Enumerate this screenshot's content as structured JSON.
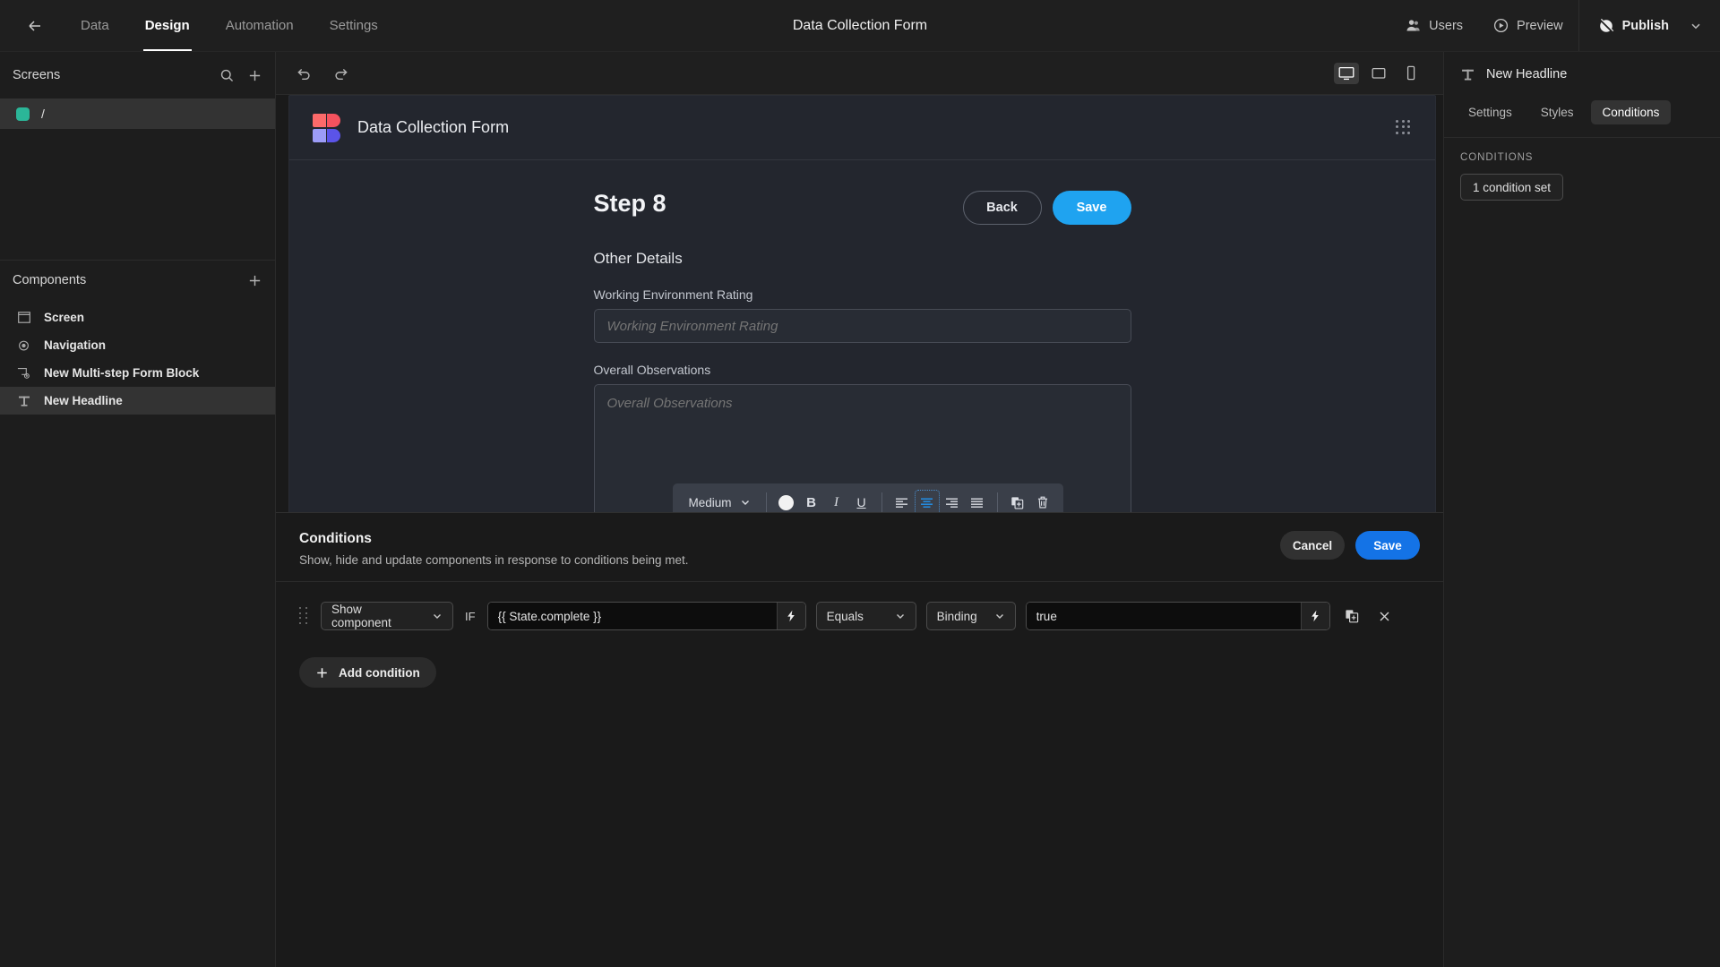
{
  "topbar": {
    "back_icon": "arrow-left-icon",
    "tabs": [
      {
        "label": "Data",
        "active": false
      },
      {
        "label": "Design",
        "active": true
      },
      {
        "label": "Automation",
        "active": false
      },
      {
        "label": "Settings",
        "active": false
      }
    ],
    "app_title": "Data Collection Form",
    "users_label": "Users",
    "preview_label": "Preview",
    "publish_label": "Publish"
  },
  "left_panel": {
    "screens_title": "Screens",
    "search_icon": "search-icon",
    "add_icon": "plus-icon",
    "screens": [
      {
        "label": "/",
        "selected": true
      }
    ],
    "components_title": "Components",
    "components_add_icon": "plus-icon",
    "components": [
      {
        "label": "Screen",
        "icon": "window-icon",
        "selected": false
      },
      {
        "label": "Navigation",
        "icon": "eye-icon",
        "selected": false
      },
      {
        "label": "New Multi-step Form Block",
        "icon": "form-block-icon",
        "selected": false
      },
      {
        "label": "New Headline",
        "icon": "text-icon",
        "selected": true
      }
    ]
  },
  "canvas_toolbar": {
    "undo_icon": "undo-icon",
    "redo_icon": "redo-icon",
    "devices": [
      {
        "name": "desktop-icon",
        "active": true
      },
      {
        "name": "tablet-icon",
        "active": false
      },
      {
        "name": "mobile-icon",
        "active": false
      }
    ]
  },
  "app_preview": {
    "logo_icon": "budibase-logo-icon",
    "app_name": "Data Collection Form",
    "grip_icon": "grip-dots-icon",
    "step_title": "Step 8",
    "back_label": "Back",
    "save_label": "Save",
    "section_title": "Other Details",
    "fields": [
      {
        "label": "Working Environment Rating",
        "placeholder": "Working Environment Rating",
        "value": "",
        "type": "text"
      },
      {
        "label": "Overall Observations",
        "placeholder": "Overall Observations",
        "value": "",
        "type": "richtext"
      }
    ],
    "rich_text_toolbar": {
      "size_label": "Medium",
      "chevron_icon": "chevron-down-icon",
      "color_swatch": "#f2f2f2",
      "bold_label": "B",
      "italic_label": "I",
      "underline_label": "U",
      "align_left_icon": "align-left-icon",
      "align_center_icon": "align-center-icon",
      "align_right_icon": "align-right-icon",
      "align_justify_icon": "align-justify-icon",
      "duplicate_icon": "duplicate-icon",
      "delete_icon": "trash-icon",
      "active_align": "center"
    }
  },
  "conditions_drawer": {
    "title": "Conditions",
    "subtitle": "Show, hide and update components in response to conditions being met.",
    "cancel_label": "Cancel",
    "save_label": "Save",
    "if_label": "IF",
    "add_condition_label": "Add condition",
    "add_icon": "plus-icon",
    "rows": [
      {
        "drag_icon": "drag-handle-icon",
        "action": "Show component",
        "binding_left": "{{ State.complete }}",
        "operator": "Equals",
        "value_type": "Binding",
        "binding_right": "true",
        "bolt_icon": "lightning-icon",
        "duplicate_icon": "duplicate-icon",
        "remove_icon": "close-icon"
      }
    ]
  },
  "right_panel": {
    "component_icon": "text-icon",
    "component_name": "New Headline",
    "tabs": [
      {
        "label": "Settings",
        "active": false
      },
      {
        "label": "Styles",
        "active": false
      },
      {
        "label": "Conditions",
        "active": true
      }
    ],
    "section_label": "CONDITIONS",
    "condition_set_label": "1 condition set"
  },
  "colors": {
    "accent_blue": "#1fa3f0",
    "drawer_save_blue": "#1473e6",
    "screen_dot_green": "#2bb698",
    "panel_bg": "#1d1d1d",
    "canvas_bg": "#1a1a1a",
    "app_frame_bg": "#23262e"
  }
}
